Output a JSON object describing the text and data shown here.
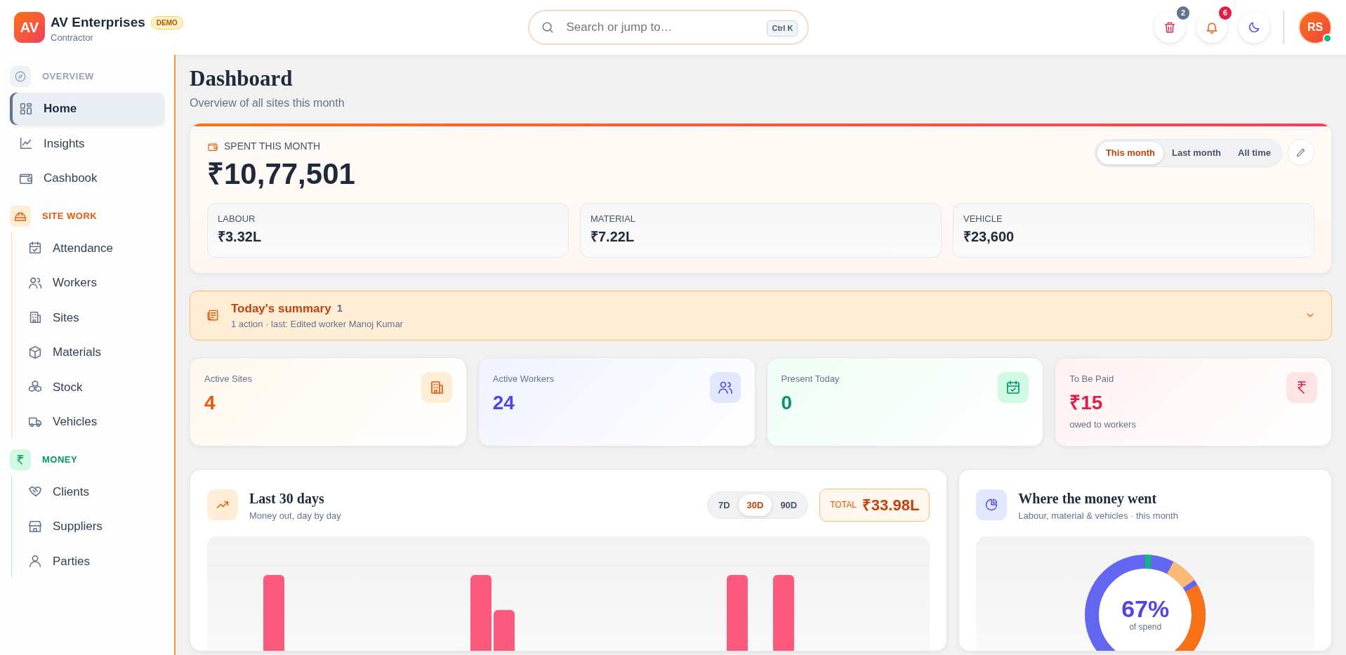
{
  "brand": {
    "logo": "AV",
    "name": "AV Enterprises",
    "badge": "DEMO",
    "subtitle": "Contractor"
  },
  "search": {
    "placeholder": "Search or jump to…",
    "shortcut": "Ctrl K"
  },
  "header_buttons": [
    {
      "kind": "trash",
      "count": "2"
    },
    {
      "kind": "bell",
      "count": "6"
    },
    {
      "kind": "theme"
    }
  ],
  "user": {
    "initials": "RS",
    "online": true
  },
  "sidebar": {
    "sections": [
      {
        "label": "OVERVIEW",
        "color": "#94a3b8",
        "items": [
          {
            "label": "Home",
            "selected": true
          },
          {
            "label": "Insights",
            "selected": false
          },
          {
            "label": "Cashbook",
            "selected": false
          }
        ]
      },
      {
        "label": "SITE WORK",
        "color": "#ea580c",
        "items": [
          {
            "label": "Attendance",
            "selected": false
          },
          {
            "label": "Workers",
            "selected": false
          },
          {
            "label": "Sites",
            "selected": false
          },
          {
            "label": "Materials",
            "selected": false
          },
          {
            "label": "Stock",
            "selected": false
          },
          {
            "label": "Vehicles",
            "selected": false
          }
        ]
      },
      {
        "label": "MONEY",
        "color": "#059669",
        "items": [
          {
            "label": "Clients",
            "selected": false
          },
          {
            "label": "Suppliers",
            "selected": false
          },
          {
            "label": "Parties",
            "selected": false
          }
        ]
      }
    ]
  },
  "page": {
    "title": "Dashboard",
    "subtitle": "Overview of all sites this month"
  },
  "spend": {
    "label": "SPENT THIS MONTH",
    "amount": "₹10,77,501",
    "periods": [
      {
        "label": "This month",
        "selected": true
      },
      {
        "label": "Last month",
        "selected": false
      },
      {
        "label": "All time",
        "selected": false
      }
    ],
    "breakdown": [
      {
        "label": "LABOUR",
        "value": "₹3.32L"
      },
      {
        "label": "MATERIAL",
        "value": "₹7.22L"
      },
      {
        "label": "VEHICLE",
        "value": "₹23,600"
      }
    ]
  },
  "summary": {
    "title": "Today's summary",
    "count": "1",
    "detail": "1 action · last: Edited worker Manoj Kumar",
    "expanded": false
  },
  "stats": [
    {
      "label": "Active Sites",
      "value": "4",
      "color": "#ea580c"
    },
    {
      "label": "Active Workers",
      "value": "24",
      "color": "#4f46e5"
    },
    {
      "label": "Present Today",
      "value": "0",
      "color": "#059669"
    },
    {
      "label": "To Be Paid",
      "value": "₹15",
      "note": "owed to workers",
      "color": "#e11d48"
    }
  ],
  "trend": {
    "title": "Last 30 days",
    "subtitle": "Money out, day by day",
    "ranges": [
      {
        "label": "7D",
        "selected": false
      },
      {
        "label": "30D",
        "selected": true
      },
      {
        "label": "90D",
        "selected": false
      }
    ],
    "total_label": "TOTAL",
    "total_value": "₹33.98L"
  },
  "breakdown_card": {
    "title": "Where the money went",
    "subtitle": "Labour, material & vehicles · this month",
    "center_value": "67%",
    "center_caption": "of spend"
  }
}
